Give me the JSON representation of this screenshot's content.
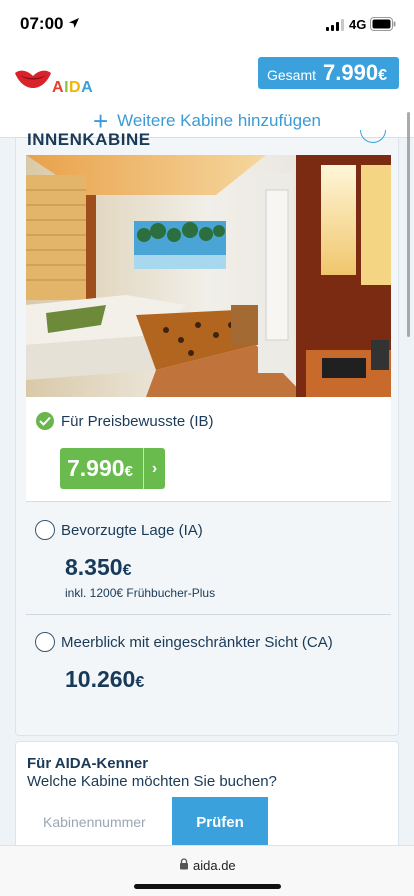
{
  "status_bar": {
    "time": "07:00",
    "network": "4G"
  },
  "header": {
    "logo_text": {
      "A1": "A",
      "I": "I",
      "D": "D",
      "A2": "A"
    },
    "total_label": "Gesamt",
    "total_value": "7.990",
    "currency": "€",
    "add_cabin_label": "Weitere Kabine hinzufügen"
  },
  "cabin": {
    "title": "INNENKABINE",
    "options": [
      {
        "name": "Für Preisbewusste (IB)",
        "price": "7.990",
        "currency": "€",
        "selected": true,
        "note": ""
      },
      {
        "name": "Bevorzugte Lage (IA)",
        "price": "8.350",
        "currency": "€",
        "selected": false,
        "note": "inkl. 1200€ Frühbucher-Plus"
      },
      {
        "name": "Meerblick mit eingeschränkter Sicht (CA)",
        "price": "10.260",
        "currency": "€",
        "selected": false,
        "note": ""
      }
    ]
  },
  "kenner": {
    "title": "Für AIDA-Kenner",
    "subtitle": "Welche Kabine möchten Sie buchen?",
    "input_placeholder": "Kabinennummer",
    "button_label": "Prüfen"
  },
  "browser": {
    "url": "aida.de"
  },
  "colors": {
    "accent": "#3ba1dc",
    "success": "#6abb4d",
    "text": "#1a3a57",
    "logo_red": "#d8232a"
  },
  "icons": [
    "location-arrow-icon",
    "signal-icon",
    "battery-icon",
    "aida-lips-logo",
    "plus-icon",
    "check-icon",
    "chevron-right-icon",
    "lock-icon"
  ]
}
